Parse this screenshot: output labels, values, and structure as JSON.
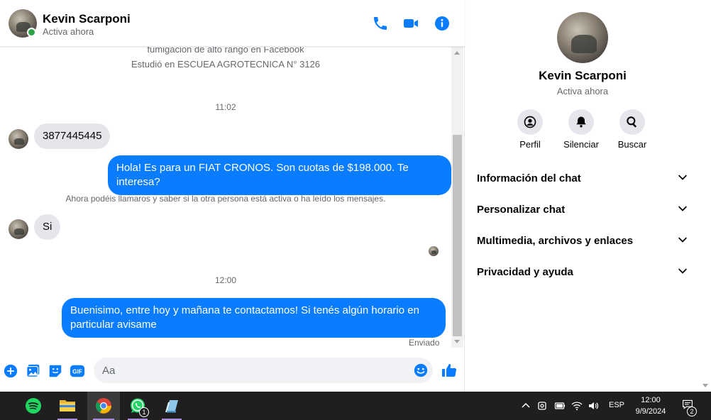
{
  "contact": {
    "name": "Kevin Scarponi",
    "status": "Activa ahora"
  },
  "chat": {
    "intro_line1": "fumigacion de alto rango en Facebook",
    "intro_line2": "Estudió en ESCUEA AGROTECNICA N° 3126",
    "messages": [
      {
        "type": "time",
        "text": "11:02"
      },
      {
        "type": "incoming",
        "text": "3877445445"
      },
      {
        "type": "outgoing",
        "text": "Hola! Es para un FIAT CRONOS. Son cuotas de $198.000. Te interesa?"
      },
      {
        "type": "system",
        "text": "Ahora podéis llamaros y saber si la otra persona está activa o ha leído los mensajes."
      },
      {
        "type": "incoming",
        "text": "Si"
      },
      {
        "type": "time",
        "text": "12:00"
      },
      {
        "type": "outgoing",
        "text": "Buenisimo, entre hoy y mañana te contactamos! Si tenés algún horario en particular avisame"
      }
    ],
    "sent_label": "Enviado"
  },
  "composer": {
    "placeholder": "Aa",
    "icons": [
      "plus-icon",
      "image-icon",
      "sticker-icon",
      "gif-icon",
      "emoji-icon",
      "thumbs-up-icon"
    ],
    "gif_label": "GIF"
  },
  "info_panel": {
    "actions": [
      {
        "label": "Perfil",
        "icon": "profile-icon"
      },
      {
        "label": "Silenciar",
        "icon": "bell-icon"
      },
      {
        "label": "Buscar",
        "icon": "search-icon"
      }
    ],
    "sections": [
      {
        "label": "Información del chat"
      },
      {
        "label": "Personalizar chat"
      },
      {
        "label": "Multimedia, archivos y enlaces"
      },
      {
        "label": "Privacidad y ayuda"
      }
    ]
  },
  "taskbar": {
    "apps": [
      {
        "name": "spotify-icon"
      },
      {
        "name": "file-explorer-icon"
      },
      {
        "name": "chrome-icon",
        "active": true
      },
      {
        "name": "whatsapp-icon",
        "badge": "1"
      },
      {
        "name": "notes-icon"
      }
    ],
    "language": "ESP",
    "time": "12:00",
    "date": "9/9/2024",
    "notification_count": "2"
  },
  "colors": {
    "accent": "#0a7cff",
    "online": "#31a24c",
    "bubble_in": "#e4e6eb",
    "taskbar": "#1f1f1f"
  }
}
